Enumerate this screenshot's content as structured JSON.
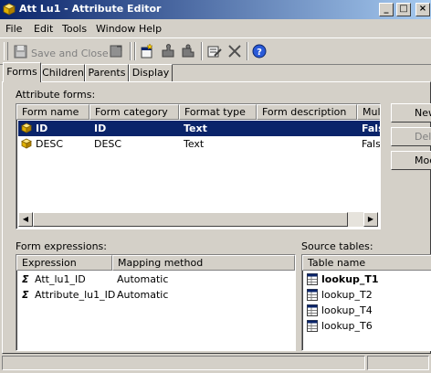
{
  "window": {
    "title": "Att Lu1 - Attribute Editor"
  },
  "title_buttons": {
    "minimize": "_",
    "maximize": "□",
    "close": "×"
  },
  "menu": [
    {
      "label": "File"
    },
    {
      "label": "Edit"
    },
    {
      "label": "Tools"
    },
    {
      "label": "Window"
    },
    {
      "label": "Help"
    }
  ],
  "toolbar": {
    "save_close_label": "Save and Close"
  },
  "tabs": [
    {
      "label": "Forms",
      "active": true
    },
    {
      "label": "Children"
    },
    {
      "label": "Parents"
    },
    {
      "label": "Display"
    }
  ],
  "attribute_forms": {
    "label": "Attribute forms:",
    "columns": [
      "Form name",
      "Form category",
      "Format type",
      "Form description",
      "Multi"
    ],
    "rows": [
      {
        "name": "ID",
        "category": "ID",
        "format": "Text",
        "description": "",
        "multi": "False",
        "selected": true
      },
      {
        "name": "DESC",
        "category": "DESC",
        "format": "Text",
        "description": "",
        "multi": "False"
      }
    ]
  },
  "side_buttons": {
    "new": "New...",
    "delete": "Delete",
    "modify": "Modify..."
  },
  "form_expressions": {
    "label": "Form expressions:",
    "columns": [
      "Expression",
      "Mapping method"
    ],
    "rows": [
      {
        "expression": "Att_lu1_ID",
        "mapping": "Automatic"
      },
      {
        "expression": "Attribute_lu1_ID",
        "mapping": "Automatic"
      }
    ]
  },
  "source_tables": {
    "label": "Source tables:",
    "columns": [
      "Table name"
    ],
    "rows": [
      {
        "name": "lookup_T1",
        "bold": true
      },
      {
        "name": "lookup_T2"
      },
      {
        "name": "lookup_T4"
      },
      {
        "name": "lookup_T6"
      }
    ]
  },
  "icons": {
    "app": "cube-icon",
    "save": "disk-icon",
    "form": "cube-icon",
    "expression": "sigma-icon",
    "table": "table-icon",
    "help": "help-icon"
  },
  "colors": {
    "selection": "#0a246a",
    "titlebar_start": "#0a246a",
    "titlebar_end": "#a6caf0",
    "face": "#d4d0c8"
  }
}
